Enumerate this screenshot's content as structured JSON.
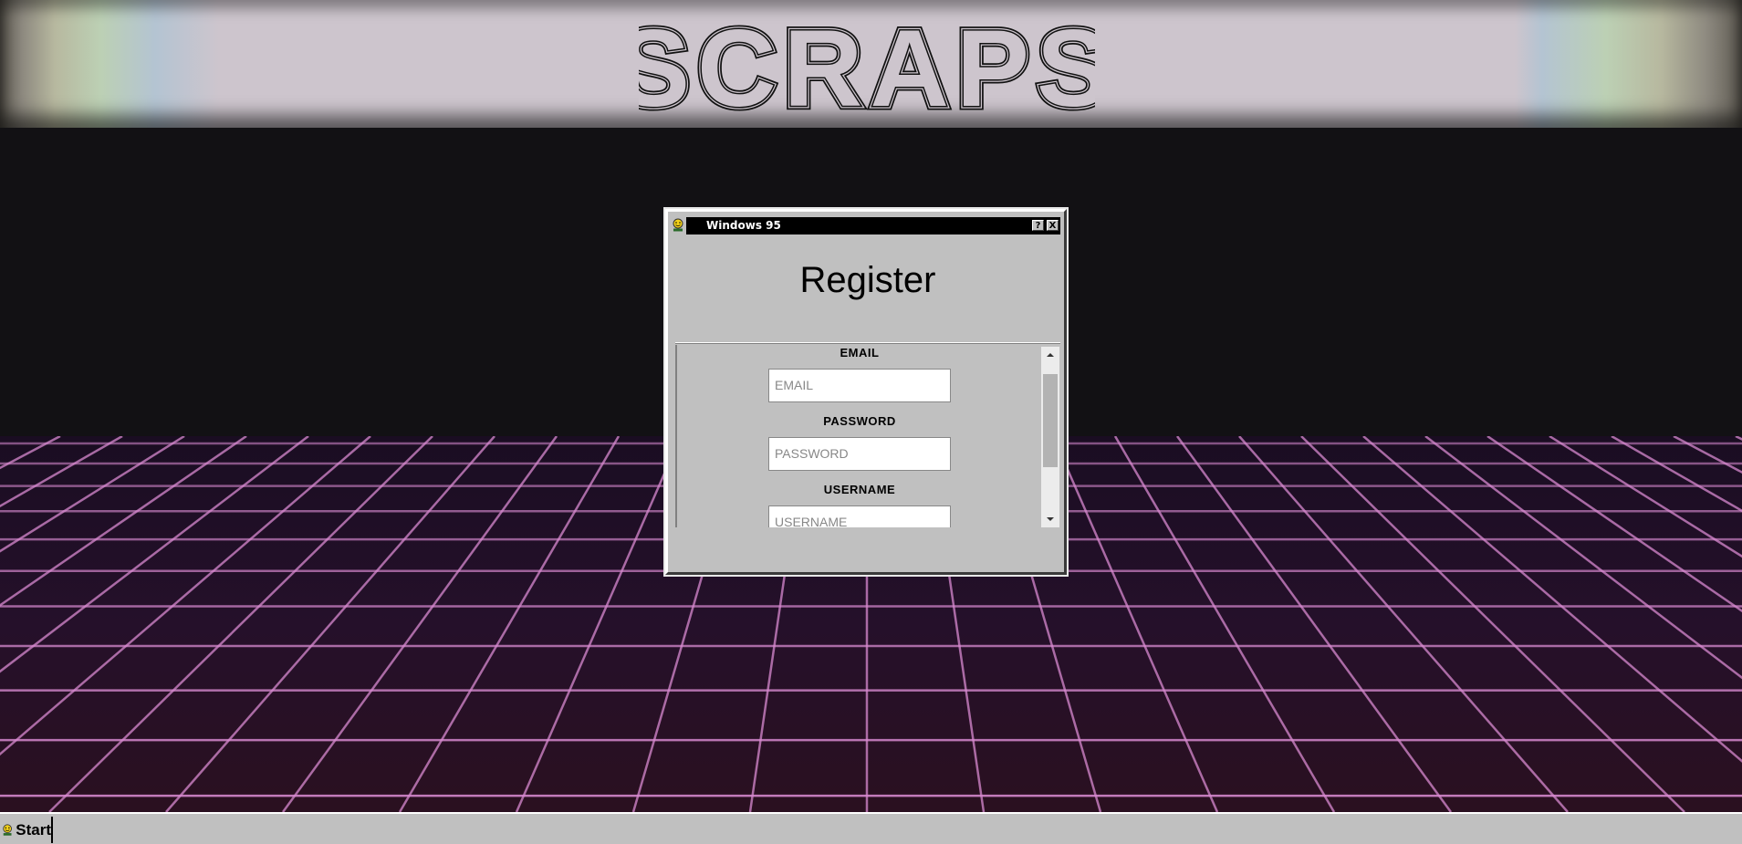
{
  "banner": {
    "title": "SCRAPS"
  },
  "window": {
    "title": "Windows 95",
    "help_button": "?",
    "close_button": "X",
    "heading": "Register"
  },
  "form": {
    "email_label": "EMAIL",
    "email_placeholder": "EMAIL",
    "password_label": "PASSWORD",
    "password_placeholder": "PASSWORD",
    "username_label": "USERNAME",
    "username_placeholder": "USERNAME"
  },
  "taskbar": {
    "start_label": "Start"
  },
  "colors": {
    "window_face": "#c0c0c0",
    "titlebar": "#000000",
    "grid_line": "#d88ad0",
    "background": "#121114"
  },
  "icons": [
    "smiley-logo-icon",
    "scroll-up-arrow-icon",
    "scroll-down-arrow-icon"
  ]
}
